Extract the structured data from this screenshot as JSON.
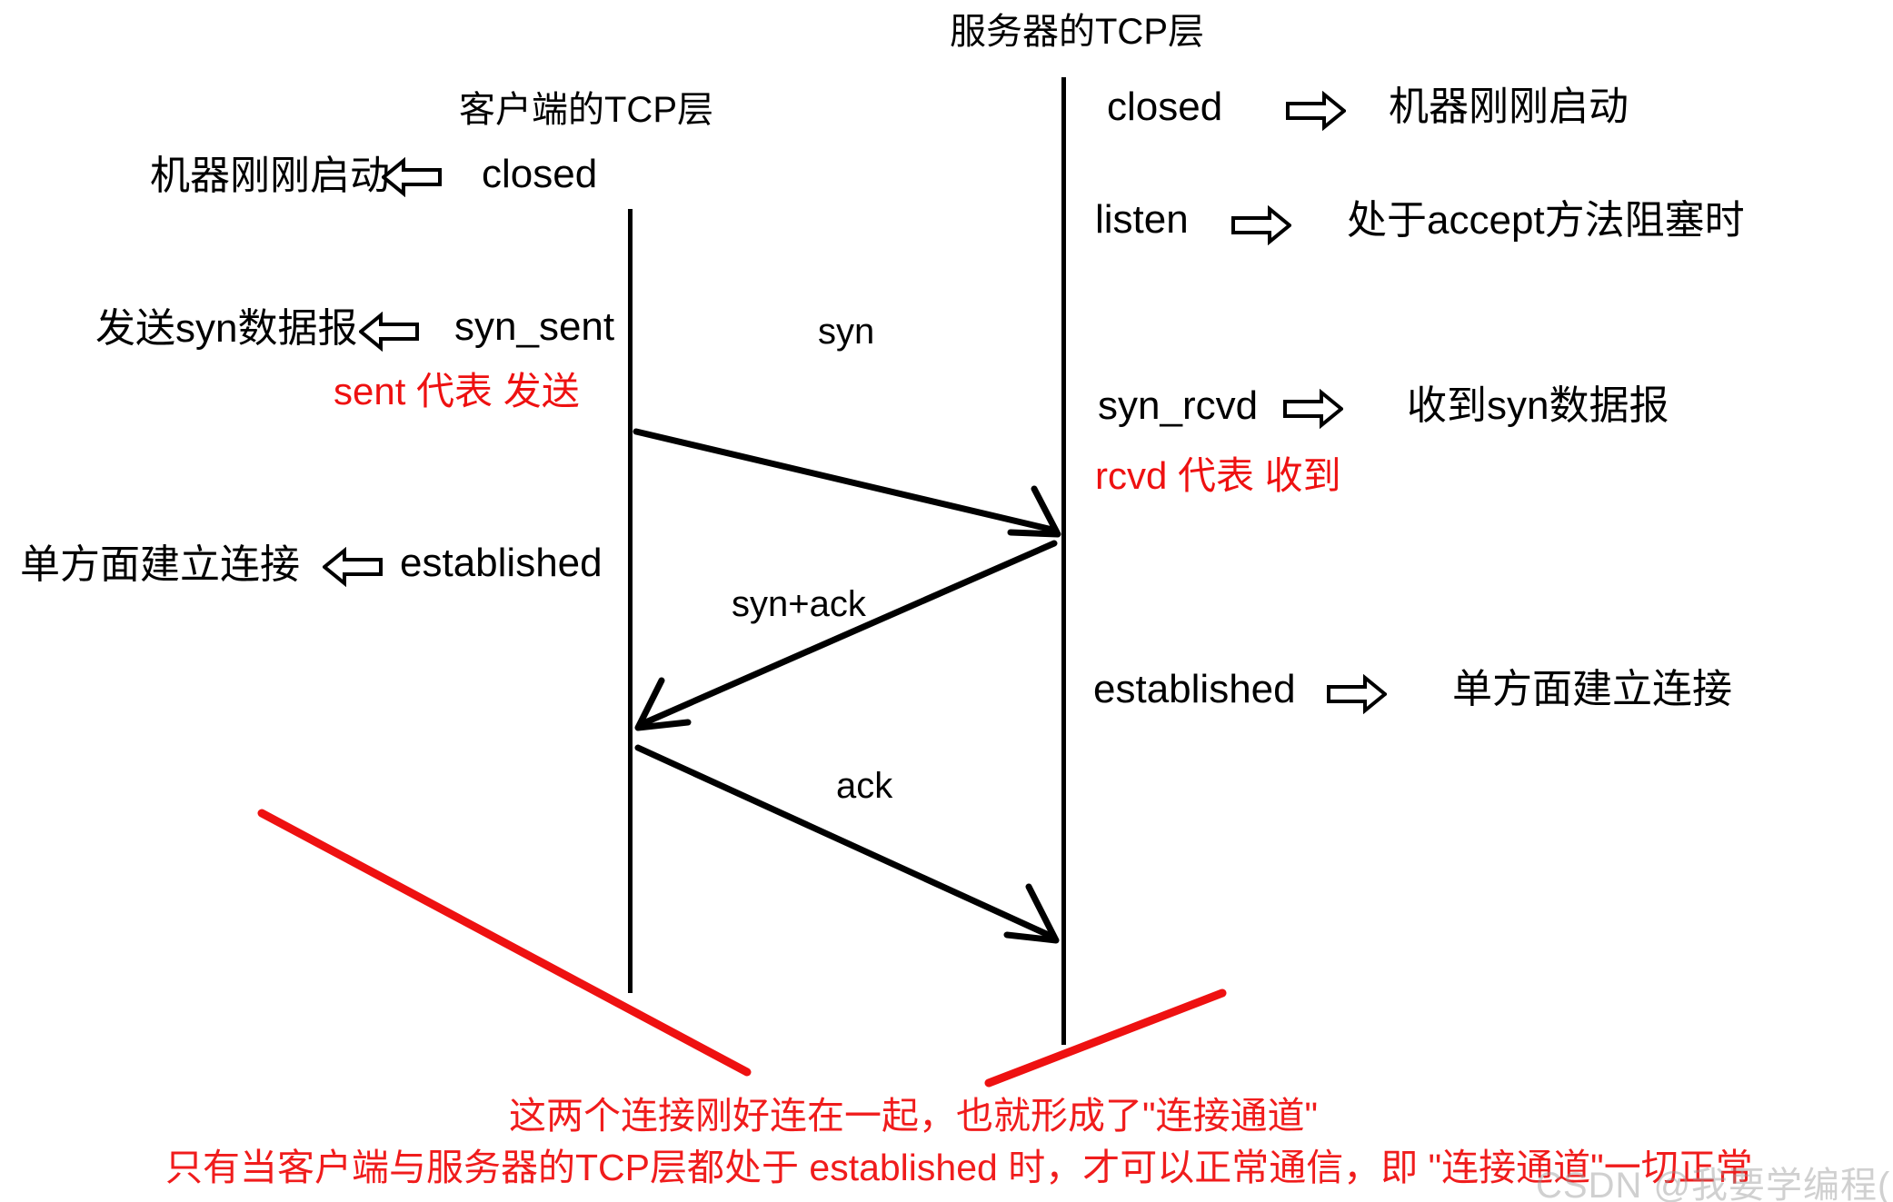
{
  "diagram": {
    "title_client": "客户端的TCP层",
    "title_server": "服务器的TCP层",
    "client_states": [
      {
        "state": "closed",
        "desc": "机器刚刚启动",
        "note": ""
      },
      {
        "state": "syn_sent",
        "desc": "发送syn数据报",
        "note": "sent 代表 发送"
      },
      {
        "state": "established",
        "desc": "单方面建立连接",
        "note": ""
      }
    ],
    "server_states": [
      {
        "state": "closed",
        "desc": "机器刚刚启动",
        "note": ""
      },
      {
        "state": "listen",
        "desc": "处于accept方法阻塞时",
        "note": ""
      },
      {
        "state": "syn_rcvd",
        "desc": "收到syn数据报",
        "note": "rcvd 代表 收到"
      },
      {
        "state": "established",
        "desc": "单方面建立连接",
        "note": ""
      }
    ],
    "messages": [
      {
        "label": "syn"
      },
      {
        "label": "syn+ack"
      },
      {
        "label": "ack"
      }
    ],
    "bottom_notes": [
      "这两个连接刚好连在一起，也就形成了\"连接通道\"",
      "只有当客户端与服务器的TCP层都处于 established 时，才可以正常通信，即 \"连接通道\"一切正常"
    ],
    "watermark": "CSDN @我要学编程(_)",
    "colors": {
      "line": "#000000",
      "accent_red": "#ee1111",
      "note_red": "#f01c1c",
      "background": "#ffffff"
    }
  }
}
